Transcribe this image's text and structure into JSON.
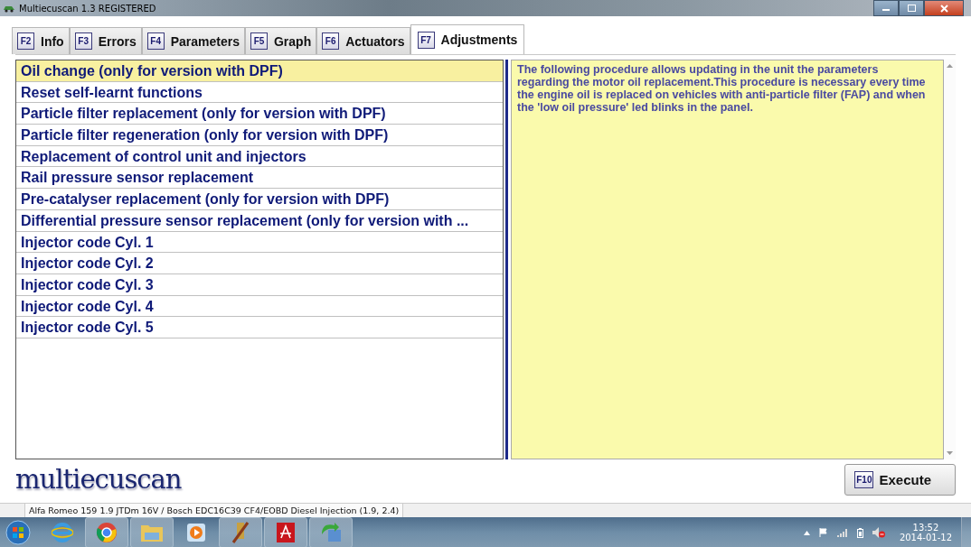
{
  "window": {
    "title": "Multiecuscan 1.3 REGISTERED"
  },
  "tabs": [
    {
      "key": "F2",
      "label": "Info",
      "selected": false
    },
    {
      "key": "F3",
      "label": "Errors",
      "selected": false
    },
    {
      "key": "F4",
      "label": "Parameters",
      "selected": false
    },
    {
      "key": "F5",
      "label": "Graph",
      "selected": false
    },
    {
      "key": "F6",
      "label": "Actuators",
      "selected": false
    },
    {
      "key": "F7",
      "label": "Adjustments",
      "selected": true
    }
  ],
  "procedures": [
    {
      "label": "Oil change (only for version with DPF)",
      "selected": true
    },
    {
      "label": "Reset self-learnt functions",
      "selected": false
    },
    {
      "label": "Particle filter replacement (only for version with DPF)",
      "selected": false
    },
    {
      "label": "Particle filter regeneration (only for version with DPF)",
      "selected": false
    },
    {
      "label": "Replacement of control unit and injectors",
      "selected": false
    },
    {
      "label": "Rail pressure sensor replacement",
      "selected": false
    },
    {
      "label": "Pre-catalyser replacement (only for version with DPF)",
      "selected": false
    },
    {
      "label": "Differential pressure sensor replacement (only for version with ...",
      "selected": false
    },
    {
      "label": "Injector code Cyl. 1",
      "selected": false
    },
    {
      "label": "Injector code Cyl. 2",
      "selected": false
    },
    {
      "label": "Injector code Cyl. 3",
      "selected": false
    },
    {
      "label": "Injector code Cyl. 4",
      "selected": false
    },
    {
      "label": "Injector code Cyl. 5",
      "selected": false
    }
  ],
  "description": "The following procedure allows updating in the unit the parameters regarding the motor oil replacement.This procedure is necessary every time the engine oil is replaced on vehicles with anti-particle filter (FAP) and when the 'low oil pressure' led blinks in the panel.",
  "logo": "multiecuscan",
  "execute_button": {
    "key": "F10",
    "label": "Execute"
  },
  "status_bar": "Alfa Romeo 159 1.9 JTDm 16V / Bosch EDC16C39 CF4/EOBD Diesel Injection (1.9, 2.4)",
  "taskbar": {
    "time": "13:52",
    "date": "2014-01-12"
  }
}
